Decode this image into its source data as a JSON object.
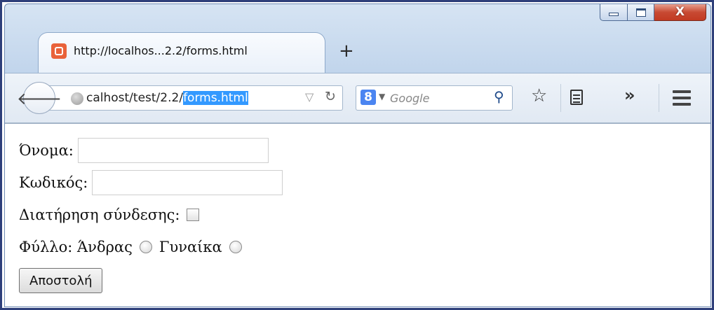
{
  "window": {
    "controls": {
      "minimize": "minimize",
      "maximize": "maximize",
      "close_label": "X"
    }
  },
  "tab": {
    "title": "http://localhos...2.2/forms.html",
    "favicon": "xampp-icon",
    "new_tab_label": "+"
  },
  "toolbar": {
    "back_icon": "back-arrow-icon",
    "url_prefix": "calhost/test/2.2/",
    "url_selected": "forms.html",
    "search_engine": "8",
    "search_placeholder": "Google",
    "icons": [
      "star-icon",
      "reading-list-icon",
      "overflow-icon",
      "menu-icon"
    ]
  },
  "form": {
    "name_label": "Όνομα:",
    "name_value": "",
    "password_label": "Κωδικός:",
    "password_value": "",
    "remember_label": "Διατήρηση σύνδεσης:",
    "remember_checked": false,
    "gender_label": "Φύλλο:",
    "gender_male_label": "Άνδρας",
    "gender_female_label": "Γυναίκα",
    "submit_label": "Αποστολή"
  }
}
